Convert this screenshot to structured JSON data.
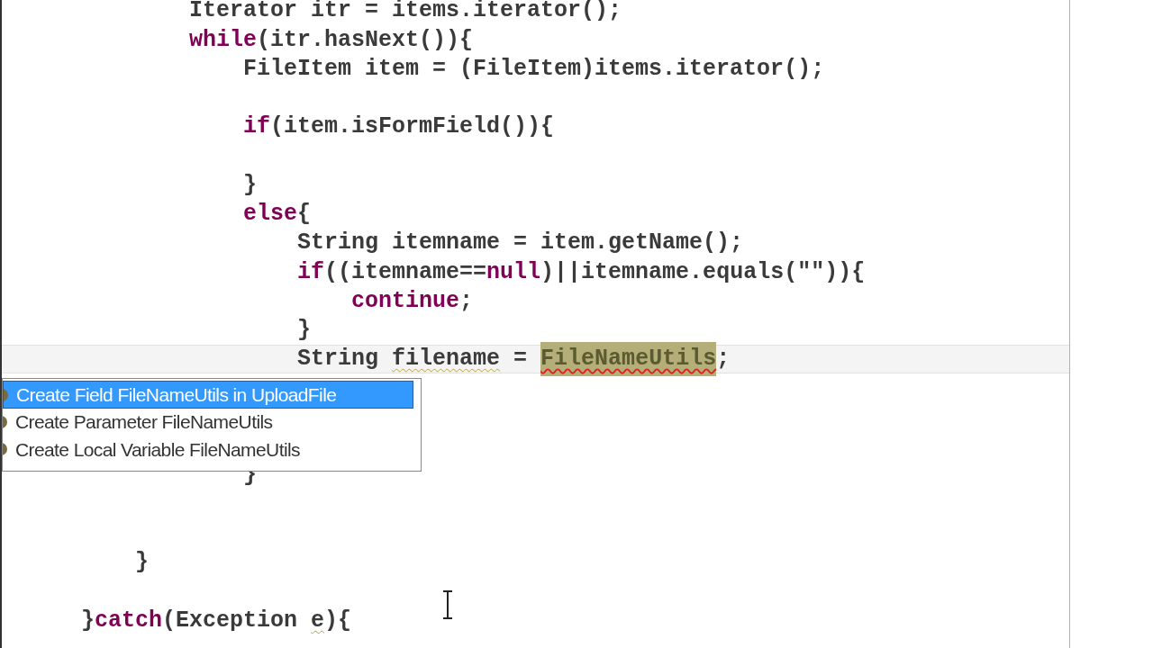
{
  "editor": {
    "lines": [
      {
        "kind": "code",
        "current": false,
        "tokens": [
          {
            "text": "        Iterator itr = items.iterator();",
            "kind": "plain"
          }
        ]
      },
      {
        "kind": "code",
        "current": false,
        "tokens": [
          {
            "text": "        while",
            "kind": "keyword"
          },
          {
            "text": "(itr.hasNext()){",
            "kind": "plain"
          }
        ]
      },
      {
        "kind": "code",
        "current": false,
        "tokens": [
          {
            "text": "            FileItem item = (FileItem)items.iterator();",
            "kind": "plain"
          }
        ]
      },
      {
        "kind": "blank"
      },
      {
        "kind": "code",
        "current": false,
        "tokens": [
          {
            "text": "            if",
            "kind": "keyword"
          },
          {
            "text": "(item.isFormField()){",
            "kind": "plain"
          }
        ]
      },
      {
        "kind": "blank"
      },
      {
        "kind": "code",
        "current": false,
        "tokens": [
          {
            "text": "            }",
            "kind": "plain"
          }
        ]
      },
      {
        "kind": "code",
        "current": false,
        "tokens": [
          {
            "text": "            else",
            "kind": "keyword"
          },
          {
            "text": "{",
            "kind": "plain"
          }
        ]
      },
      {
        "kind": "code",
        "current": false,
        "tokens": [
          {
            "text": "                String itemname = item.getName();",
            "kind": "plain"
          }
        ]
      },
      {
        "kind": "code",
        "current": false,
        "tokens": [
          {
            "text": "                if",
            "kind": "keyword"
          },
          {
            "text": "((itemname==",
            "kind": "plain"
          },
          {
            "text": "null",
            "kind": "keyword"
          },
          {
            "text": ")||itemname.equals(\"\")){",
            "kind": "plain"
          }
        ]
      },
      {
        "kind": "code",
        "current": false,
        "tokens": [
          {
            "text": "                    continue",
            "kind": "keyword"
          },
          {
            "text": ";",
            "kind": "plain"
          }
        ]
      },
      {
        "kind": "code",
        "current": false,
        "tokens": [
          {
            "text": "                }",
            "kind": "plain"
          }
        ]
      },
      {
        "kind": "code",
        "current": true,
        "tokens": [
          {
            "text": "                String ",
            "kind": "plain"
          },
          {
            "text": "filename",
            "kind": "warning"
          },
          {
            "text": " = ",
            "kind": "plain"
          },
          {
            "text": "FileNameUtils",
            "kind": "error"
          },
          {
            "text": ";",
            "kind": "plain"
          }
        ]
      },
      {
        "kind": "blank"
      },
      {
        "kind": "blank"
      },
      {
        "kind": "blank"
      },
      {
        "kind": "code",
        "current": false,
        "tokens": [
          {
            "text": "            }",
            "kind": "plain"
          }
        ]
      },
      {
        "kind": "blank"
      },
      {
        "kind": "blank"
      },
      {
        "kind": "code",
        "current": false,
        "tokens": [
          {
            "text": "    }",
            "kind": "plain"
          }
        ]
      },
      {
        "kind": "blank"
      },
      {
        "kind": "code",
        "current": false,
        "tokens": [
          {
            "text": "}",
            "kind": "plain"
          },
          {
            "text": "catch",
            "kind": "keyword"
          },
          {
            "text": "(Exception ",
            "kind": "plain"
          },
          {
            "text": "e",
            "kind": "warning"
          },
          {
            "text": "){",
            "kind": "plain"
          }
        ]
      }
    ]
  },
  "quick_fix": {
    "items": [
      {
        "label": "Create Field FileNameUtils in UploadFile",
        "selected": true
      },
      {
        "label": "Create Parameter FileNameUtils",
        "selected": false
      },
      {
        "label": "Create Local Variable FileNameUtils",
        "selected": false
      }
    ]
  }
}
